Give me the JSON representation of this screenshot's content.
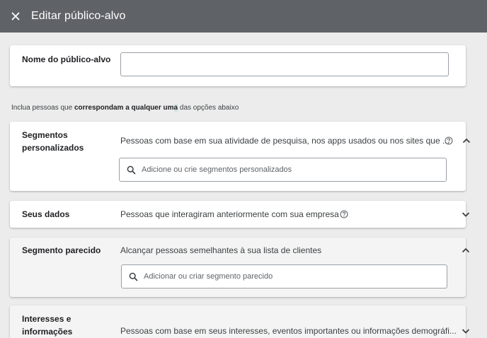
{
  "header": {
    "title": "Editar público-alvo"
  },
  "audience_name": {
    "label": "Nome do público-alvo",
    "value": ""
  },
  "instruction": {
    "prefix": "Inclua pessoas que ",
    "bold": "correspondam a qualquer um",
    "cursor_char": "a",
    "suffix": " das opções abaixo"
  },
  "sections": {
    "custom_segments": {
      "label": "Segmentos personalizados",
      "description": "Pessoas com base em sua atividade de pesquisa, nos apps usados ou nos sites que ...",
      "search_placeholder": "Adicione ou crie segmentos personalizados",
      "expanded": true
    },
    "your_data": {
      "label": "Seus dados",
      "description": "Pessoas que interagiram anteriormente com sua empresa",
      "expanded": false
    },
    "similar_segment": {
      "label": "Segmento parecido",
      "description": "Alcançar pessoas semelhantes à sua lista de clientes",
      "search_placeholder": "Adicionar ou criar segmento parecido",
      "expanded": true
    },
    "interests": {
      "label": "Interesses e informações",
      "description": "Pessoas com base em seus interesses, eventos importantes ou informações demográfi...",
      "expanded": false
    }
  },
  "icons": {
    "close": "close-icon",
    "search": "search-icon",
    "help": "help-circle-icon",
    "expand": "chevron-down-icon",
    "collapse": "chevron-up-icon"
  }
}
